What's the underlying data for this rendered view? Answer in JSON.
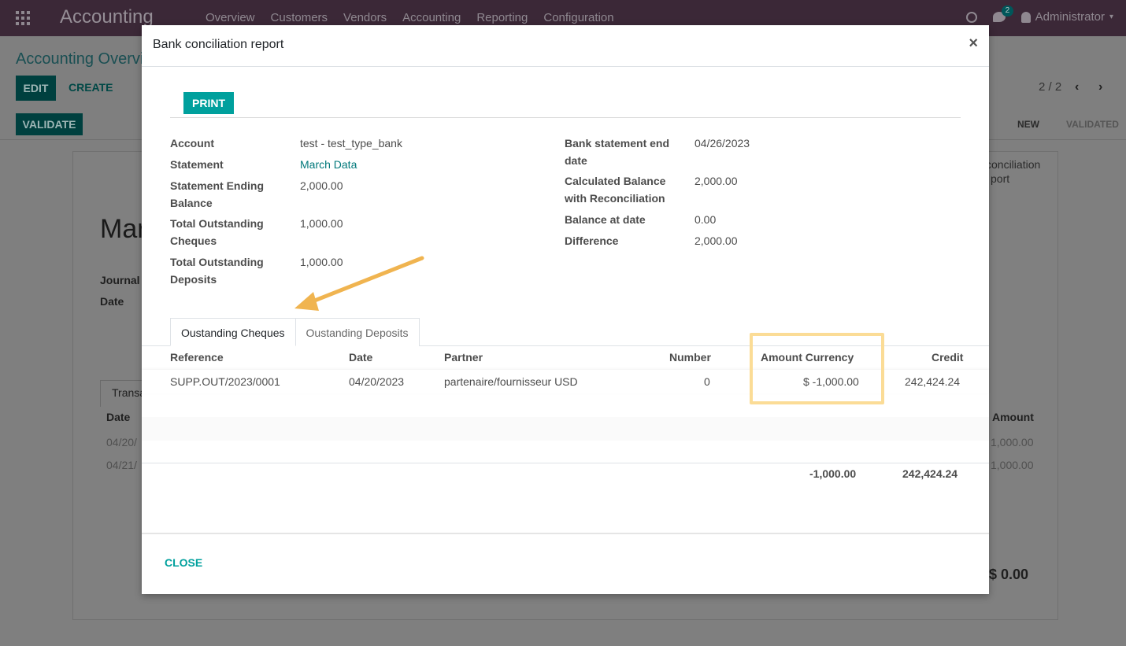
{
  "navbar": {
    "brand": "Accounting",
    "menu": [
      "Overview",
      "Customers",
      "Vendors",
      "Accounting",
      "Reporting",
      "Configuration"
    ],
    "chat_count": "2",
    "user": "Administrator"
  },
  "control_panel": {
    "breadcrumb": "Accounting Overvi",
    "edit_label": "EDIT",
    "create_label": "CREATE",
    "validate_label": "VALIDATE",
    "pager": "2 / 2",
    "status_new": "NEW",
    "status_validated": "VALIDATED"
  },
  "sheet": {
    "stat_line1": "conciliation",
    "stat_line2": "port",
    "name": "Mar",
    "journal_label": "Journal",
    "date_label": "Date",
    "tab_label": "Transa",
    "col_date": "Date",
    "col_amount": "Amount",
    "rows": [
      {
        "date": "04/20/",
        "amount": "1,000.00"
      },
      {
        "date": "04/21/",
        "amount": "1,000.00"
      }
    ],
    "total": "$ 0.00"
  },
  "modal": {
    "title": "Bank conciliation report",
    "close_x": "×",
    "print_label": "PRINT",
    "left_fields": [
      {
        "label": "Account",
        "value": "test - test_type_bank"
      },
      {
        "label": "Statement",
        "value": "March Data"
      },
      {
        "label": "Statement Ending Balance",
        "value": "2,000.00"
      },
      {
        "label": "Total Outstanding Cheques",
        "value": "1,000.00"
      },
      {
        "label": "Total Outstanding Deposits",
        "value": "1,000.00"
      }
    ],
    "right_fields": [
      {
        "label": "Bank statement end date",
        "value": "04/26/2023"
      },
      {
        "label": "Calculated Balance with Reconciliation",
        "value": "2,000.00"
      },
      {
        "label": "Balance at date",
        "value": "0.00"
      },
      {
        "label": "Difference",
        "value": "2,000.00"
      }
    ],
    "tabs": [
      "Oustanding Cheques",
      "Oustanding Deposits"
    ],
    "columns": [
      "Reference",
      "Date",
      "Partner",
      "Number",
      "Amount Currency",
      "Credit"
    ],
    "rows": [
      {
        "reference": "SUPP.OUT/2023/0001",
        "date": "04/20/2023",
        "partner": "partenaire/fournisseur USD",
        "number": "0",
        "amount_currency": "$ -1,000.00",
        "credit": "242,424.24"
      }
    ],
    "totals": {
      "amount_currency": "-1,000.00",
      "credit": "242,424.24"
    },
    "close_label": "CLOSE"
  },
  "colors": {
    "accent": "#00a09d",
    "navbar": "#3b2837",
    "highlight": "#fbdc96",
    "arrow": "#f0b450"
  }
}
